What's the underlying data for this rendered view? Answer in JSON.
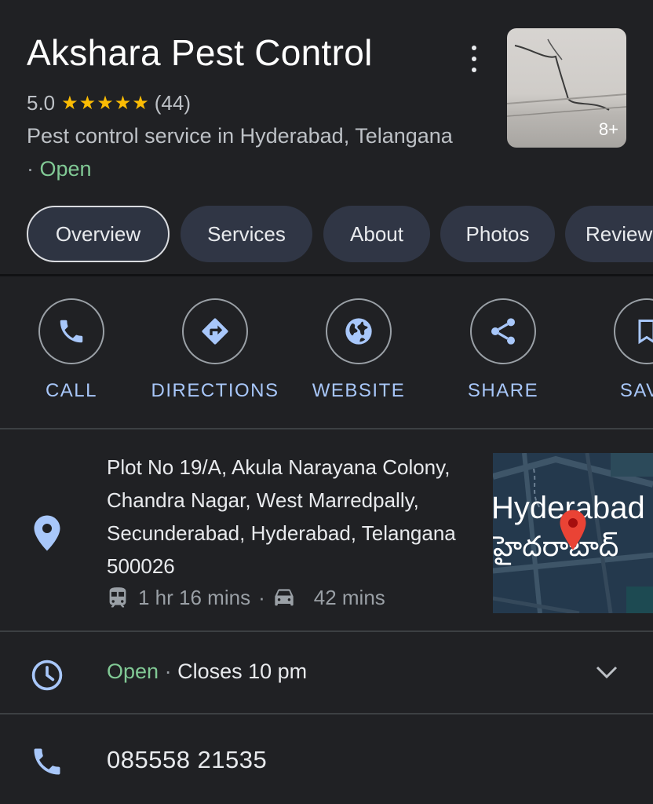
{
  "place": {
    "name": "Akshara Pest Control",
    "rating": "5.0",
    "stars": "★★★★★",
    "review_count": "(44)",
    "category": "Pest control service in Hyderabad, Telangana",
    "status_separator": "·",
    "status": "Open",
    "photo_count": "8+"
  },
  "tabs": [
    {
      "label": "Overview",
      "active": true
    },
    {
      "label": "Services"
    },
    {
      "label": "About"
    },
    {
      "label": "Photos"
    },
    {
      "label": "Reviews"
    }
  ],
  "actions": [
    {
      "label": "CALL",
      "icon": "phone-icon"
    },
    {
      "label": "DIRECTIONS",
      "icon": "directions-icon"
    },
    {
      "label": "WEBSITE",
      "icon": "globe-icon"
    },
    {
      "label": "SHARE",
      "icon": "share-icon"
    },
    {
      "label": "SAVE",
      "icon": "bookmark-icon"
    }
  ],
  "address": {
    "text": "Plot No 19/A, Akula Narayana Colony, Chandra Nagar, West Marredpally, Secunderabad, Hyderabad, Telangana 500026",
    "transit_time": "1 hr 16 mins",
    "separator": "·",
    "drive_time": "42 mins",
    "map_label": "Hyderabad",
    "map_label_local": "హైదరాబాద్"
  },
  "hours": {
    "status": "Open",
    "separator": "·",
    "closes": "Closes 10 pm"
  },
  "phone": {
    "number": "085558 21535"
  },
  "colors": {
    "background": "#202124",
    "accent_blue": "#a8c7fa",
    "open_green": "#81c995",
    "star_yellow": "#fbbc04",
    "map_pin_red": "#ea4335"
  }
}
